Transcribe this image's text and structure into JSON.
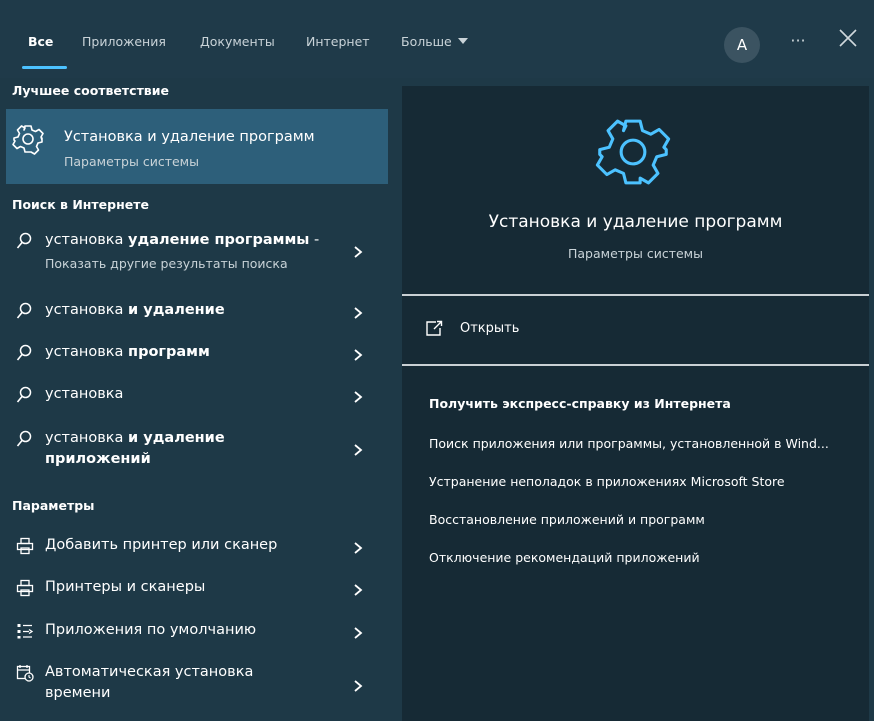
{
  "tabs": {
    "all": "Все",
    "apps": "Приложения",
    "documents": "Документы",
    "internet": "Интернет",
    "more": "Больше"
  },
  "account": {
    "avatar_letter": "A"
  },
  "more_menu": "···",
  "sections": {
    "best_match": "Лучшее соответствие",
    "web_search": "Поиск в Интернете",
    "settings": "Параметры"
  },
  "best_match": {
    "title": "Установка и удаление программ",
    "subtitle": "Параметры системы",
    "icon": "gear-icon"
  },
  "web_results": [
    {
      "plain": "установка ",
      "bold": "удаление программы",
      "suffix": " -",
      "sub": "Показать другие результаты поиска"
    },
    {
      "plain": "установка ",
      "bold": "и удаление"
    },
    {
      "plain": "установка ",
      "bold": "программ"
    },
    {
      "plain": "установка",
      "bold": ""
    },
    {
      "plain": "установка ",
      "bold": "и удаление",
      "line2": "приложений"
    }
  ],
  "settings_results": [
    {
      "label": "Добавить принтер или сканер",
      "icon": "printer-icon"
    },
    {
      "label": "Принтеры и сканеры",
      "icon": "printer-icon"
    },
    {
      "label": "Приложения по умолчанию",
      "icon": "default-apps-icon"
    },
    {
      "label": "Автоматическая установка",
      "line2": "времени",
      "icon": "calendar-clock-icon"
    }
  ],
  "preview": {
    "title": "Установка и удаление программ",
    "subtitle": "Параметры системы",
    "open_label": "Открыть",
    "help_heading": "Получить экспресс-справку из Интернета",
    "help_links": [
      "Поиск приложения или программы, установленной в Wind...",
      "Устранение неполадок в приложениях Microsoft Store",
      "Восстановление приложений и программ",
      "Отключение рекомендаций приложений"
    ]
  },
  "colors": {
    "background": "#1e3947",
    "preview_background": "#162a35",
    "selected_row": "#2d5f7a",
    "accent": "#4cc2ff"
  }
}
